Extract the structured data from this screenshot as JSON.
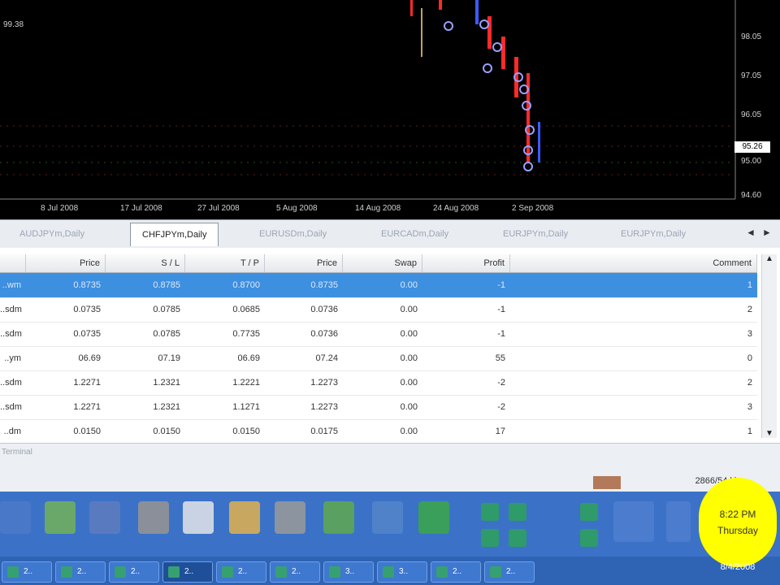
{
  "chart": {
    "left_price_label": "99.38",
    "price_labels": [
      "98.05",
      "97.05",
      "96.05",
      "95.00",
      "94.60"
    ],
    "current_price": "95.26",
    "date_labels": [
      "8 Jul 2008",
      "17 Jul 2008",
      "27 Jul 2008",
      "5 Aug 2008",
      "14 Aug 2008",
      "24 Aug 2008",
      "2 Sep 2008"
    ]
  },
  "tabs": {
    "items": [
      "AUDJPYm,Daily",
      "CHFJPYm,Daily",
      "EURUSDm,Daily",
      "EURCADm,Daily",
      "EURJPYm,Daily",
      "EURJPYm,Daily"
    ],
    "active_index": 1,
    "nav_prev": "◄",
    "nav_next": "►"
  },
  "table": {
    "headers": [
      "Price",
      "S / L",
      "T / P",
      "Price",
      "Swap",
      "Profit",
      "Comment"
    ],
    "rows": [
      {
        "sym": "..wm",
        "price": "0.8735",
        "sl": "0.8785",
        "tp": "0.8700",
        "cur": "0.8735",
        "swap": "0.00",
        "profit": "-1",
        "comment": "1"
      },
      {
        "sym": "..sdm",
        "price": "0.0735",
        "sl": "0.0785",
        "tp": "0.0685",
        "cur": "0.0736",
        "swap": "0.00",
        "profit": "-1",
        "comment": "2"
      },
      {
        "sym": "..sdm",
        "price": "0.0735",
        "sl": "0.0785",
        "tp": "0.7735",
        "cur": "0.0736",
        "swap": "0.00",
        "profit": "-1",
        "comment": "3"
      },
      {
        "sym": "..ym",
        "price": "06.69",
        "sl": "07.19",
        "tp": "06.69",
        "cur": "07.24",
        "swap": "0.00",
        "profit": "55",
        "comment": "0"
      },
      {
        "sym": "..sdm",
        "price": "1.2271",
        "sl": "1.2321",
        "tp": "1.2221",
        "cur": "1.2273",
        "swap": "0.00",
        "profit": "-2",
        "comment": "2"
      },
      {
        "sym": "..sdm",
        "price": "1.2271",
        "sl": "1.2321",
        "tp": "1.1271",
        "cur": "1.2273",
        "swap": "0.00",
        "profit": "-2",
        "comment": "3"
      },
      {
        "sym": "..dm",
        "price": "0.0150",
        "sl": "0.0150",
        "tp": "0.0150",
        "cur": "0.0175",
        "swap": "0.00",
        "profit": "17",
        "comment": "1"
      }
    ]
  },
  "status": {
    "left": "Terminal",
    "right": "2866/54 kb"
  },
  "taskbar": {
    "items": [
      "2..",
      "2..",
      "2..",
      "2..",
      "2..",
      "2..",
      "3..",
      "3..",
      "2..",
      "2.."
    ],
    "active_index": 3
  },
  "clock": {
    "time": "8:22 PM",
    "day": "Thursday",
    "date": "8/4/2008"
  },
  "colors": {
    "candle_red": "#ff2a2a",
    "candle_blue": "#3b5bff",
    "selected_row": "#3d8fe0",
    "clock_highlight": "#ffff00"
  }
}
